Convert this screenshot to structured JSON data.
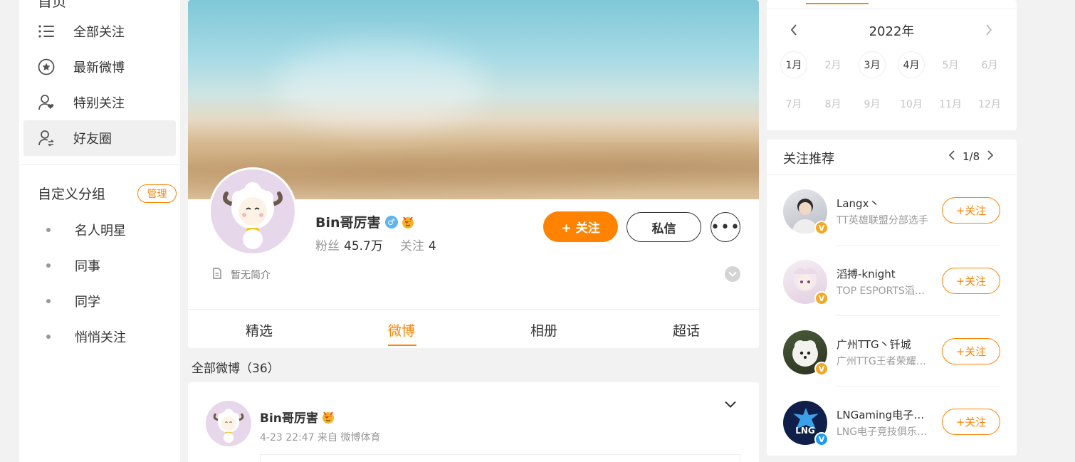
{
  "left_nav": {
    "header": "首页",
    "items": [
      {
        "label": "全部关注",
        "icon": "list-icon"
      },
      {
        "label": "最新微博",
        "icon": "star-circle-icon"
      },
      {
        "label": "特别关注",
        "icon": "user-heart-icon"
      },
      {
        "label": "好友圈",
        "icon": "user-friends-icon",
        "active": true
      }
    ],
    "custom_group_title": "自定义分组",
    "manage_label": "管理",
    "groups": [
      "名人明星",
      "同事",
      "同学",
      "悄悄关注"
    ]
  },
  "profile": {
    "name": "Bin哥厉害",
    "gender_symbol": "♂",
    "fans_label": "粉丝",
    "fans_value": "45.7万",
    "following_label": "关注",
    "following_value": "4",
    "follow_button": "+ 关注",
    "message_button": "私信",
    "more_button": "•••",
    "bio": "暂无简介",
    "tabs": [
      "精选",
      "微博",
      "相册",
      "超话"
    ],
    "active_tab": "微博"
  },
  "feed": {
    "all_posts_label": "全部微博（36）",
    "post": {
      "author": "Bin哥厉害",
      "meta": "4-23 22:47  来自 微博体育"
    }
  },
  "calendar": {
    "year": "2022年",
    "months": [
      "1月",
      "2月",
      "3月",
      "4月",
      "5月",
      "6月",
      "7月",
      "8月",
      "9月",
      "10月",
      "11月",
      "12月"
    ],
    "active_months": [
      "1月",
      "3月",
      "4月"
    ]
  },
  "recommend": {
    "title": "关注推荐",
    "pager": "1/8",
    "follow_label": "+关注",
    "items": [
      {
        "name": "Langx丶",
        "desc": "TT英雄联盟分部选手",
        "badge_color": "#f5a623"
      },
      {
        "name": "滔搏-knight",
        "desc": "TOP ESPORTS滔搏电竞",
        "badge_color": "#f5a623"
      },
      {
        "name": "广州TTG丶钎城",
        "desc": "广州TTG王者荣耀分部",
        "badge_color": "#f5a623"
      },
      {
        "name": "LNGaming电子竞技俱乐部",
        "desc": "LNG电子竞技俱乐部官方",
        "badge_color": "#1d9bf0"
      }
    ]
  },
  "colors": {
    "accent": "#ff8200"
  }
}
